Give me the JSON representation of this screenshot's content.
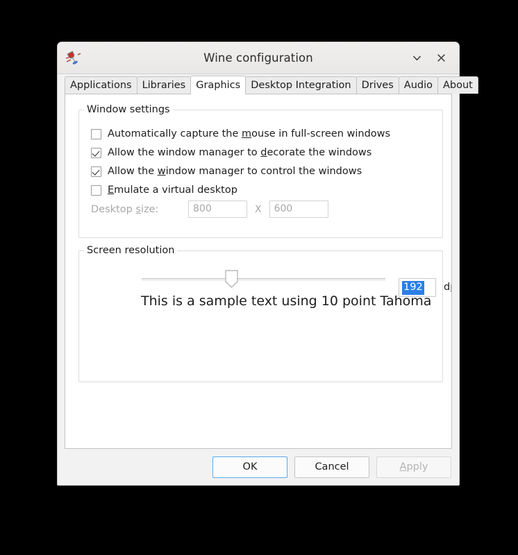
{
  "window": {
    "title": "Wine configuration",
    "icon": "wine-glass-icon",
    "controls": {
      "collapse": "chevron-down-icon",
      "close": "close-icon"
    }
  },
  "tabs": [
    {
      "label": "Applications",
      "active": false
    },
    {
      "label": "Libraries",
      "active": false
    },
    {
      "label": "Graphics",
      "active": true
    },
    {
      "label": "Desktop Integration",
      "active": false
    },
    {
      "label": "Drives",
      "active": false
    },
    {
      "label": "Audio",
      "active": false
    },
    {
      "label": "About",
      "active": false
    }
  ],
  "window_settings": {
    "title": "Window settings",
    "checkboxes": [
      {
        "pre": "Automatically capture the ",
        "acc": "m",
        "post": "ouse in full-screen windows",
        "checked": false
      },
      {
        "pre": "Allow the window manager to ",
        "acc": "d",
        "post": "ecorate the windows",
        "checked": true
      },
      {
        "pre": "Allow the ",
        "acc": "w",
        "post": "indow manager to control the windows",
        "checked": true
      },
      {
        "pre": "",
        "acc": "E",
        "post": "mulate a virtual desktop",
        "checked": false
      }
    ],
    "desktop_size": {
      "label_pre": "Desktop ",
      "label_acc": "s",
      "label_post": "ize:",
      "width": "800",
      "separator": "X",
      "height": "600",
      "disabled": true
    }
  },
  "screen_resolution": {
    "title": "Screen resolution",
    "slider_position_percent": 37,
    "dpi_value": "192",
    "dpi_unit": "dpi",
    "dpi_selected": true,
    "sample_text": "This is a sample text using 10 point Tahoma"
  },
  "buttons": {
    "ok": "OK",
    "cancel": "Cancel",
    "apply_pre": "",
    "apply_acc": "A",
    "apply_post": "pply",
    "apply_disabled": true
  },
  "colors": {
    "selection_blue": "#2a7fe8",
    "focus_blue": "#5aa7e8",
    "disabled_gray": "#a8a8a8"
  }
}
